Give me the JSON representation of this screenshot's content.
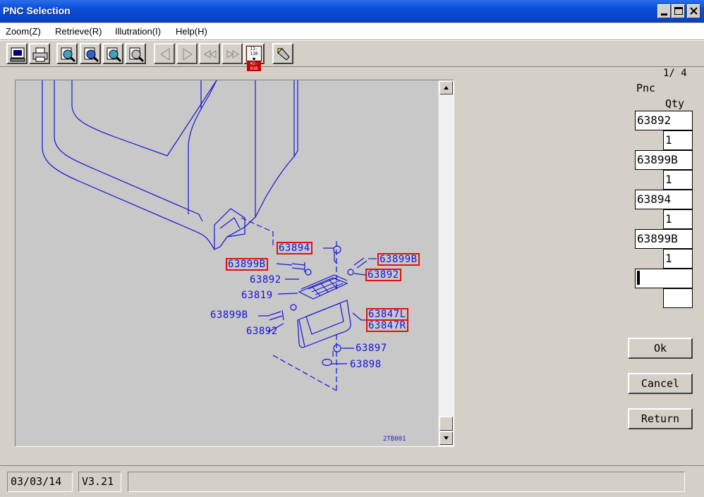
{
  "window": {
    "title": "PNC Selection"
  },
  "menu": [
    {
      "label": "Zoom(Z)"
    },
    {
      "label": "Retrieve(R)"
    },
    {
      "label": "Illutration(I)"
    },
    {
      "label": "Help(H)"
    }
  ],
  "toolbar": {
    "icons": [
      "print-preview-icon",
      "printer-icon",
      "zoom-in-icon",
      "zoom-out-icon",
      "zoom-fit-icon",
      "zoom-full-icon",
      "prev-icon",
      "next-icon",
      "rewind-icon",
      "fast-forward-icon",
      "page-range-icon",
      "flashlight-icon"
    ],
    "page_range_top": "11-110",
    "page_range_bottom": "42-010"
  },
  "drawing": {
    "labels": [
      {
        "text": "63894",
        "boxed": true
      },
      {
        "text": "63899B",
        "boxed": true
      },
      {
        "text": "63899B",
        "boxed": true
      },
      {
        "text": "63892",
        "boxed": false
      },
      {
        "text": "63892",
        "boxed": true
      },
      {
        "text": "63819",
        "boxed": false
      },
      {
        "text": "63899B",
        "boxed": false
      },
      {
        "text": "63847L",
        "boxed": true
      },
      {
        "text": "63847R",
        "boxed": true
      },
      {
        "text": "63892",
        "boxed": false
      },
      {
        "text": "63897",
        "boxed": false
      },
      {
        "text": "63898",
        "boxed": false
      }
    ],
    "code": "2TB001",
    "line_color": "#1414d4",
    "box_color": "#e01010"
  },
  "panel": {
    "page": "1/ 4",
    "pnc_header": "Pnc",
    "qty_header": "Qty",
    "rows": [
      {
        "pnc": "63892",
        "qty": "1"
      },
      {
        "pnc": "63899B",
        "qty": "1"
      },
      {
        "pnc": "63894",
        "qty": "1"
      },
      {
        "pnc": "63899B",
        "qty": "1"
      },
      {
        "pnc": "",
        "qty": ""
      }
    ]
  },
  "buttons": {
    "ok": "Ok",
    "cancel": "Cancel",
    "return": "Return"
  },
  "status": {
    "date": "03/03/14",
    "version": "V3.21",
    "message": ""
  }
}
